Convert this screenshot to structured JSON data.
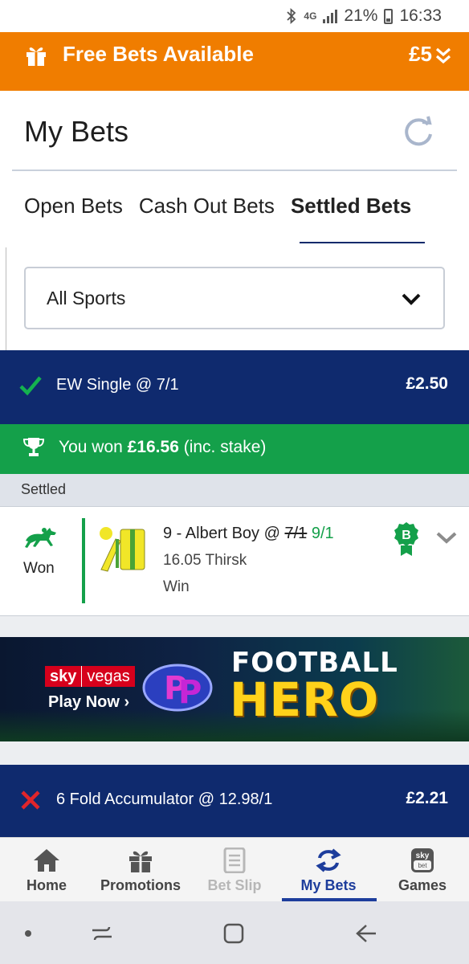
{
  "status_bar": {
    "network": "4G",
    "battery": "21%",
    "time": "16:33"
  },
  "free_bets": {
    "title": "Free Bets Available",
    "amount": "£5"
  },
  "header": {
    "title": "My Bets"
  },
  "tabs": [
    {
      "label": "Open Bets",
      "active": false
    },
    {
      "label": "Cash Out Bets",
      "active": false
    },
    {
      "label": "Settled Bets",
      "active": true
    }
  ],
  "filter": {
    "selected": "All Sports"
  },
  "bets": [
    {
      "type": "EW Single @ 7/1",
      "stake": "£2.50",
      "status": "won",
      "winnings_prefix": "You won",
      "winnings_amount": "£16.56",
      "winnings_suffix": "(inc. stake)",
      "section_label": "Settled",
      "selection": {
        "result": "Won",
        "runner": "9 - Albert Boy @",
        "old_odds": "7/1",
        "new_odds": "9/1",
        "race": "16.05 Thirsk",
        "market": "Win",
        "badge": "B"
      }
    },
    {
      "type": "6 Fold Accumulator @ 12.98/1",
      "stake": "£2.21",
      "status": "lost"
    }
  ],
  "promo": {
    "brand_sky": "sky",
    "brand_vegas": "vegas",
    "cta": "Play Now ›",
    "game_line1": "FOOTBALL",
    "game_line2": "HERO"
  },
  "bottom_nav": [
    {
      "label": "Home",
      "icon": "home-icon",
      "state": "normal"
    },
    {
      "label": "Promotions",
      "icon": "gift-icon",
      "state": "normal"
    },
    {
      "label": "Bet Slip",
      "icon": "betslip-icon",
      "state": "disabled"
    },
    {
      "label": "My Bets",
      "icon": "mybets-icon",
      "state": "active"
    },
    {
      "label": "Games",
      "icon": "skybet-games-icon",
      "state": "normal"
    }
  ],
  "games_icon_text": {
    "top": "sky",
    "bottom": "bet"
  },
  "colors": {
    "orange": "#f07d00",
    "navy": "#0f2a6e",
    "green": "#14a04a",
    "active_blue": "#1d3d9c",
    "lost_red": "#e0252b"
  }
}
